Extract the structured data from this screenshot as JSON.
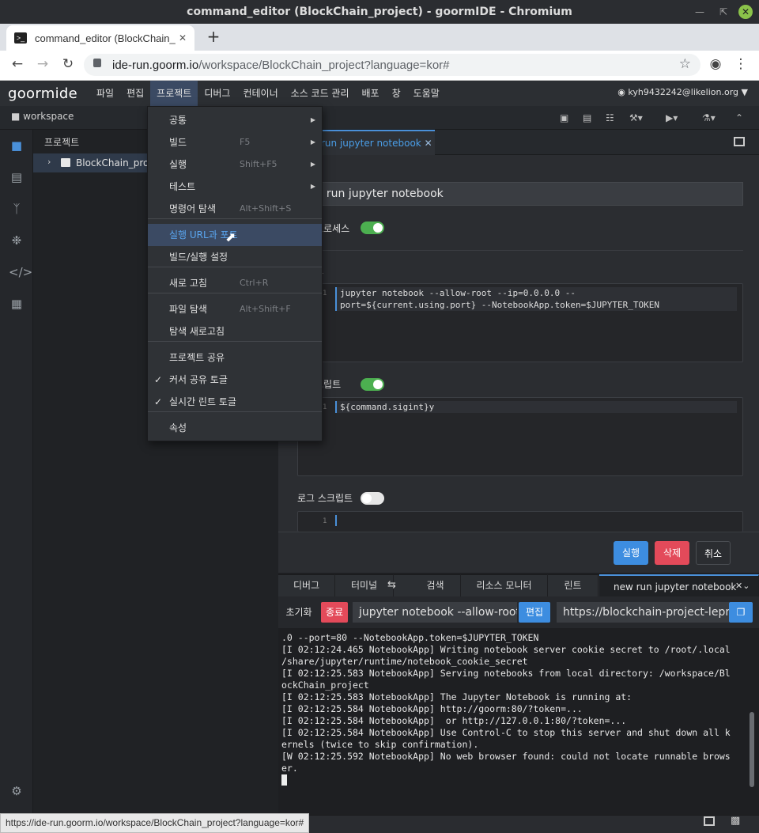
{
  "window": {
    "title": "command_editor (BlockChain_project) - goormIDE - Chromium"
  },
  "browser": {
    "tab_title": "command_editor (BlockChain_",
    "url_host": "ide-run.goorm.io",
    "url_path": "/workspace/BlockChain_project?language=kor#",
    "status_url": "https://ide-run.goorm.io/workspace/BlockChain_project?language=kor#"
  },
  "ide": {
    "logo": "goormide",
    "menu": [
      "파일",
      "편집",
      "프로젝트",
      "디버그",
      "컨테이너",
      "소스 코드 관리",
      "배포",
      "창",
      "도움말"
    ],
    "user": "kyh9432242@likelion.org",
    "workspace_label": "workspace",
    "sidebar_title": "프로젝트",
    "tree_item": "BlockChain_pro"
  },
  "dropdown": [
    {
      "label": "공통",
      "shortcut": "",
      "submenu": true,
      "checked": false
    },
    {
      "label": "빌드",
      "shortcut": "F5",
      "submenu": true,
      "checked": false
    },
    {
      "label": "실행",
      "shortcut": "Shift+F5",
      "submenu": true,
      "checked": false
    },
    {
      "label": "테스트",
      "shortcut": "",
      "submenu": true,
      "checked": false
    },
    {
      "label": "명령어 탐색",
      "shortcut": "Alt+Shift+S",
      "submenu": false,
      "checked": false
    },
    {
      "label": "실행 URL과 포트",
      "shortcut": "",
      "submenu": false,
      "checked": false
    },
    {
      "label": "빌드/실행 설정",
      "shortcut": "",
      "submenu": false,
      "checked": false
    },
    {
      "label": "새로 고침",
      "shortcut": "Ctrl+R",
      "submenu": false,
      "checked": false
    },
    {
      "label": "파일 탐색",
      "shortcut": "Alt+Shift+F",
      "submenu": false,
      "checked": false
    },
    {
      "label": "탐색 새로고침",
      "shortcut": "",
      "submenu": false,
      "checked": false
    },
    {
      "label": "프로젝트 공유",
      "shortcut": "",
      "submenu": false,
      "checked": false
    },
    {
      "label": "커서 공유 토글",
      "shortcut": "",
      "submenu": false,
      "checked": true
    },
    {
      "label": "실시간 린트 토글",
      "shortcut": "",
      "submenu": false,
      "checked": true
    },
    {
      "label": "속성",
      "shortcut": "",
      "submenu": false,
      "checked": false
    }
  ],
  "editor": {
    "tab_label": "run jupyter notebook",
    "name_value": "w run jupyter notebook",
    "process_label": "프로세스",
    "script_label": "트",
    "code_line1": "jupyter notebook --allow-root --ip=0.0.0.0 --",
    "code_line2": "port=${current.using.port} --NotebookApp.token=$JUPYTER_TOKEN",
    "stop_label": "크립트",
    "stop_code": "${command.sigint}y",
    "log_label": "로그 스크립트",
    "run_button": "실행",
    "delete_button": "삭제",
    "cancel_button": "취소"
  },
  "panel": {
    "tabs": [
      "디버그",
      "터미널",
      "검색",
      "리소스 모니터",
      "린트",
      "new run jupyter notebook"
    ],
    "reset_label": "초기화",
    "stop_label": "종료",
    "command_value": "jupyter notebook --allow-root",
    "edit_label": "편집",
    "url_value": "https://blockchain-project-lepr",
    "terminal_output": ".0 --port=80 --NotebookApp.token=$JUPYTER_TOKEN\n[I 02:12:24.465 NotebookApp] Writing notebook server cookie secret to /root/.local\n/share/jupyter/runtime/notebook_cookie_secret\n[I 02:12:25.583 NotebookApp] Serving notebooks from local directory: /workspace/Bl\nockChain_project\n[I 02:12:25.583 NotebookApp] The Jupyter Notebook is running at:\n[I 02:12:25.584 NotebookApp] http://goorm:80/?token=...\n[I 02:12:25.584 NotebookApp]  or http://127.0.0.1:80/?token=...\n[I 02:12:25.584 NotebookApp] Use Control-C to stop this server and shut down all k\nernels (twice to skip confirmation).\n[W 02:12:25.592 NotebookApp] No web browser found: could not locate runnable brows\ner."
  }
}
